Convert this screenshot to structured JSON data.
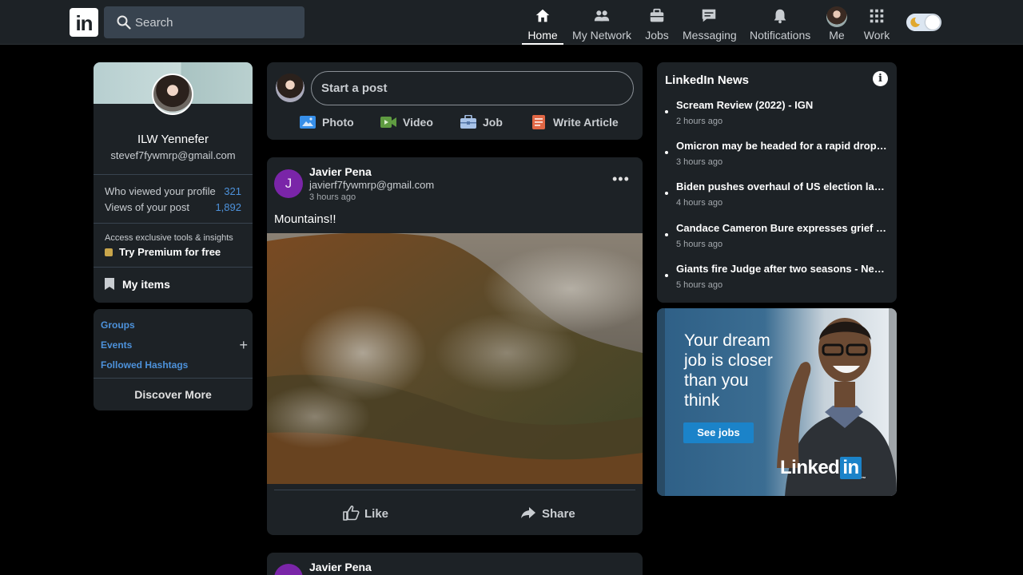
{
  "header": {
    "logo_text": "in",
    "search_placeholder": "Search",
    "nav": [
      {
        "label": "Home",
        "icon": "home-icon"
      },
      {
        "label": "My Network",
        "icon": "network-icon"
      },
      {
        "label": "Jobs",
        "icon": "briefcase-icon"
      },
      {
        "label": "Messaging",
        "icon": "message-icon"
      },
      {
        "label": "Notifications",
        "icon": "bell-icon"
      },
      {
        "label": "Me",
        "icon": "avatar"
      },
      {
        "label": "Work",
        "icon": "grid-icon"
      }
    ]
  },
  "profile": {
    "name": "ILW Yennefer",
    "email": "stevef7fywmrp@gmail.com",
    "stats": [
      {
        "label": "Who viewed your profile",
        "value": "321"
      },
      {
        "label": "Views of your post",
        "value": "1,892"
      }
    ],
    "access_text": "Access exclusive tools & insights",
    "premium_label": "Try Premium for free",
    "my_items_label": "My items"
  },
  "groups": {
    "links": [
      "Groups",
      "Events",
      "Followed Hashtags"
    ],
    "plus": "+",
    "discover_label": "Discover More"
  },
  "share_box": {
    "placeholder": "Start a post",
    "actions": [
      {
        "label": "Photo",
        "icon": "photo-icon",
        "color": "#378fe9"
      },
      {
        "label": "Video",
        "icon": "video-icon",
        "color": "#5f9b41"
      },
      {
        "label": "Job",
        "icon": "job-icon",
        "color": "#a8c3e8"
      },
      {
        "label": "Write Article",
        "icon": "article-icon",
        "color": "#e16745"
      }
    ]
  },
  "post": {
    "avatar_letter": "J",
    "author": "Javier Pena",
    "email": "javierf7fywmrp@gmail.com",
    "time": "3 hours ago",
    "text": "Mountains!!",
    "more": "•••",
    "like_label": "Like",
    "share_label": "Share"
  },
  "post2": {
    "author": "Javier Pena"
  },
  "news": {
    "title": "LinkedIn News",
    "info": "i",
    "items": [
      {
        "title": "Scream Review (2022) - IGN",
        "time": "2 hours ago"
      },
      {
        "title": "Omicron may be headed for a rapid drop in cases",
        "time": "3 hours ago"
      },
      {
        "title": "Biden pushes overhaul of US election laws in Atlanta",
        "time": "4 hours ago"
      },
      {
        "title": "Candace Cameron Bure expresses grief following death",
        "time": "5 hours ago"
      },
      {
        "title": "Giants fire Judge after two seasons - New York Post",
        "time": "5 hours ago"
      }
    ]
  },
  "ad": {
    "headline": "Your dream job is closer than you think",
    "button": "See jobs",
    "brand_text": "Linked",
    "brand_in": "in",
    "brand_tm": "™"
  },
  "colors": {
    "accent_blue": "#4d92db",
    "header_bg": "#1d2226",
    "card_bg": "#1d2226",
    "page_bg": "#000000",
    "avatar_purple": "#7a25a8"
  }
}
